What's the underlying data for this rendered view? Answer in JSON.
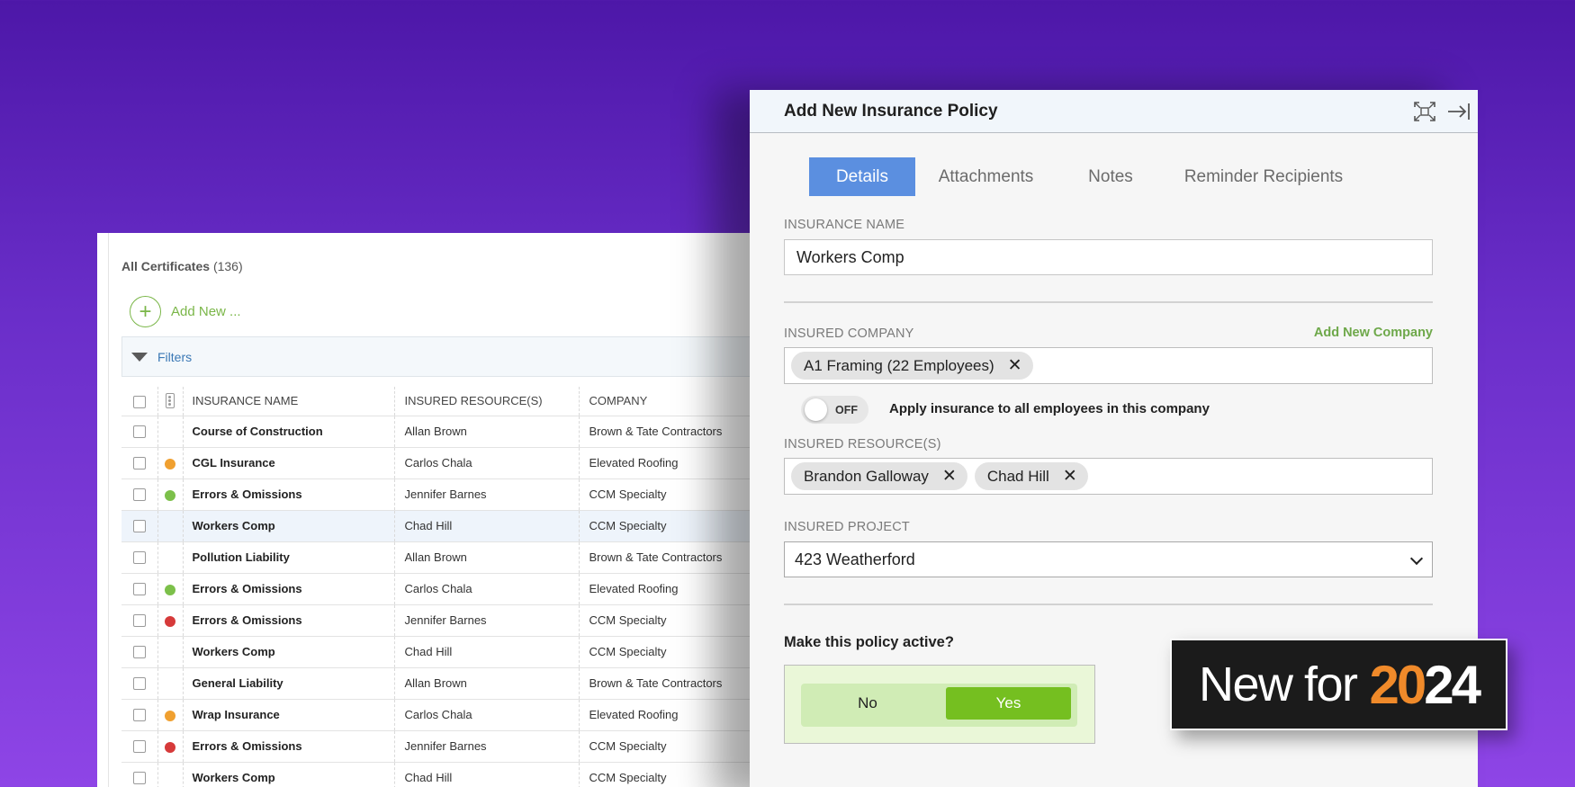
{
  "list": {
    "title": "All Certificates",
    "count": "(136)",
    "add_new": "Add New ...",
    "filters": "Filters",
    "columns": [
      "INSURANCE NAME",
      "INSURED RESOURCE(S)",
      "COMPANY"
    ],
    "rows": [
      {
        "name": "Course of Construction",
        "resource": "Allan Brown",
        "company": "Brown & Tate Contractors",
        "status": ""
      },
      {
        "name": "CGL Insurance",
        "resource": "Carlos Chala",
        "company": "Elevated Roofing",
        "status": "#f0a030"
      },
      {
        "name": "Errors & Omissions",
        "resource": "Jennifer Barnes",
        "company": "CCM Specialty",
        "status": "#7cc04a"
      },
      {
        "name": "Workers Comp",
        "resource": "Chad Hill",
        "company": "CCM Specialty",
        "status": ""
      },
      {
        "name": "Pollution Liability",
        "resource": "Allan Brown",
        "company": "Brown & Tate Contractors",
        "status": ""
      },
      {
        "name": "Errors & Omissions",
        "resource": "Carlos Chala",
        "company": "Elevated Roofing",
        "status": "#7cc04a"
      },
      {
        "name": "Errors & Omissions",
        "resource": "Jennifer Barnes",
        "company": "CCM Specialty",
        "status": "#d63a3a"
      },
      {
        "name": "Workers Comp",
        "resource": "Chad Hill",
        "company": "CCM Specialty",
        "status": ""
      },
      {
        "name": "General Liability",
        "resource": "Allan Brown",
        "company": "Brown & Tate Contractors",
        "status": ""
      },
      {
        "name": "Wrap Insurance",
        "resource": "Carlos Chala",
        "company": "Elevated Roofing",
        "status": "#f0a030"
      },
      {
        "name": "Errors & Omissions",
        "resource": "Jennifer Barnes",
        "company": "CCM Specialty",
        "status": "#d63a3a"
      },
      {
        "name": "Workers Comp",
        "resource": "Chad Hill",
        "company": "CCM Specialty",
        "status": ""
      }
    ],
    "highlighted_row": 3
  },
  "modal": {
    "title": "Add New Insurance Policy",
    "tabs": [
      "Details",
      "Attachments",
      "Notes",
      "Reminder Recipients"
    ],
    "active_tab": 0,
    "insurance_name_label": "INSURANCE NAME",
    "insurance_name_value": "Workers Comp",
    "insured_company_label": "INSURED COMPANY",
    "add_new_company": "Add New Company",
    "company_chips": [
      "A1 Framing (22 Employees)"
    ],
    "toggle_state": "OFF",
    "toggle_label": "Apply insurance to all employees in this company",
    "insured_resources_label": "INSURED RESOURCE(S)",
    "resource_chips": [
      "Brandon Galloway",
      "Chad Hill"
    ],
    "insured_project_label": "INSURED PROJECT",
    "insured_project_value": "423 Weatherford",
    "active_question": "Make this policy active?",
    "no_label": "No",
    "yes_label": "Yes",
    "selected": "Yes"
  },
  "badge": {
    "text": "New for",
    "year_part1": "20",
    "year_part2": "24"
  },
  "icons": {
    "expand": "expand-icon",
    "collapse": "collapse-right-icon",
    "remove": "✕"
  }
}
